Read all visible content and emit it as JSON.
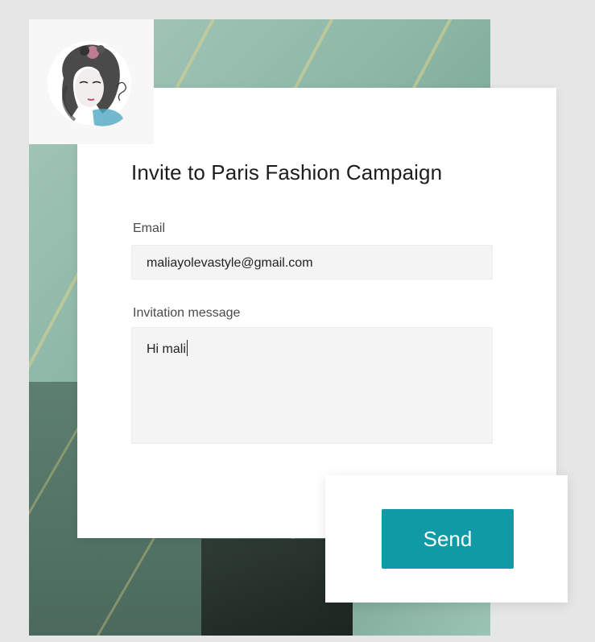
{
  "form": {
    "title": "Invite to Paris Fashion Campaign",
    "email_label": "Email",
    "email_value": "maliayolevastyle@gmail.com",
    "message_label": "Invitation message",
    "message_value": "Hi mali"
  },
  "actions": {
    "send_label": "Send"
  },
  "avatar": {
    "icon": "fashion-illustration-avatar"
  },
  "colors": {
    "accent": "#0f9aa5",
    "field_bg": "#f4f4f4",
    "page_bg": "#e6e6e6"
  }
}
